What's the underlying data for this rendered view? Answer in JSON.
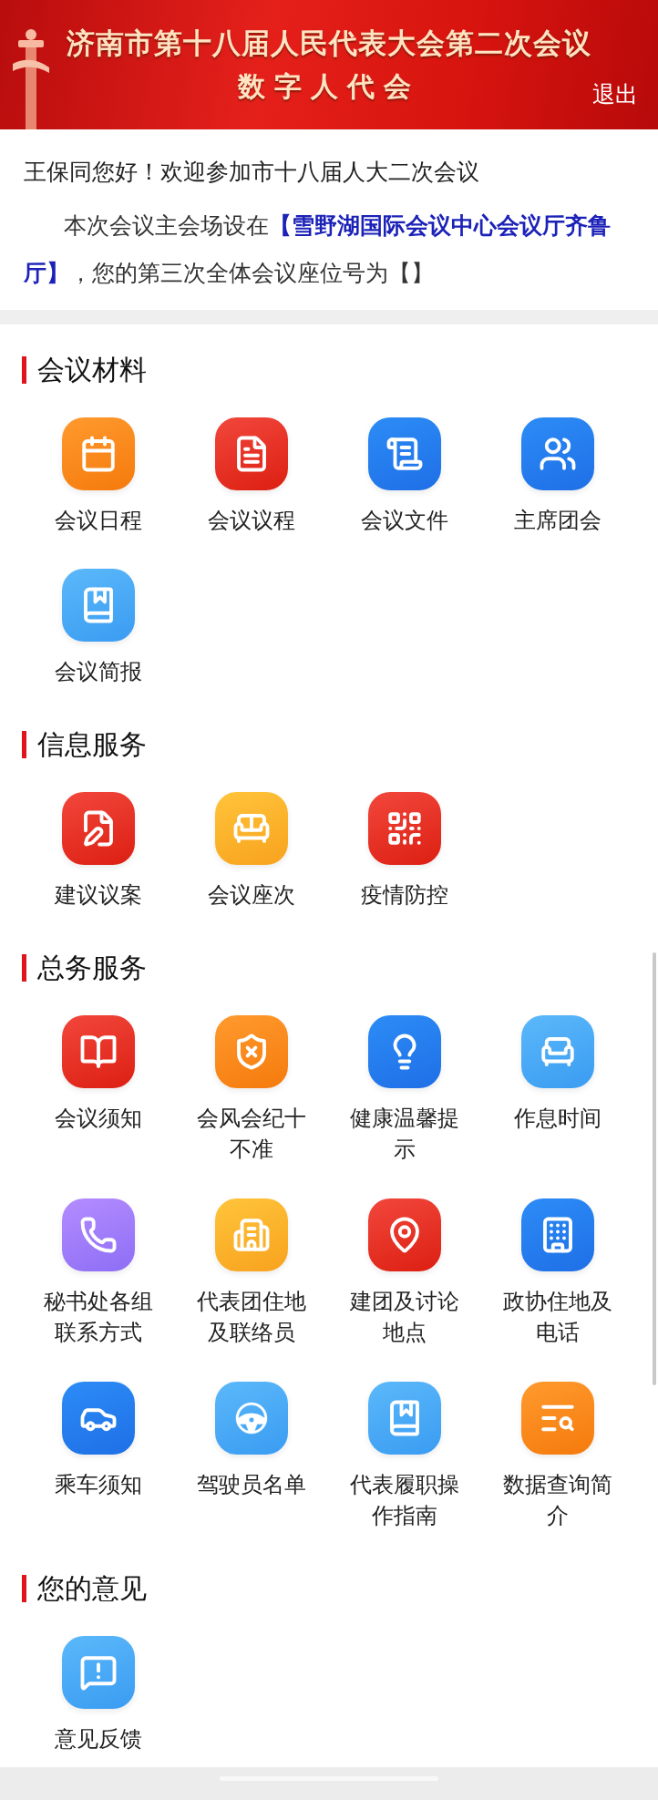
{
  "header": {
    "title": "济南市第十八届人民代表大会第二次会议",
    "subtitle": "数字人代会",
    "logout": "退出"
  },
  "welcome": {
    "greeting": "王保同您好！欢迎参加市十八届人大二次会议",
    "notice": "本次会议主会场设在**【雪野湖国际会议中心会议厅齐鲁厅】**，您的第三次全体会议座位号为【】"
  },
  "sections": [
    {
      "title": "会议材料",
      "items": [
        {
          "label": "会议日程",
          "kind": "calendar"
        },
        {
          "label": "会议议程",
          "kind": "document"
        },
        {
          "label": "会议文件",
          "kind": "scroll"
        },
        {
          "label": "主席团会",
          "kind": "group"
        },
        {
          "label": "会议简报",
          "kind": "book"
        }
      ]
    },
    {
      "title": "信息服务",
      "items": [
        {
          "label": "建议议案",
          "kind": "edit"
        },
        {
          "label": "会议座次",
          "kind": "sofa"
        },
        {
          "label": "疫情防控",
          "kind": "qr"
        }
      ]
    },
    {
      "title": "总务服务",
      "items": [
        {
          "label": "会议须知",
          "kind": "handbook"
        },
        {
          "label": "会风会纪十不准",
          "kind": "shield"
        },
        {
          "label": "健康温馨提示",
          "kind": "bulb"
        },
        {
          "label": "作息时间",
          "kind": "seat"
        },
        {
          "label": "秘书处各组联系方式",
          "kind": "contact"
        },
        {
          "label": "代表团住地及联络员",
          "kind": "building"
        },
        {
          "label": "建团及讨论地点",
          "kind": "location"
        },
        {
          "label": "政协住地及电话",
          "kind": "office"
        },
        {
          "label": "乘车须知",
          "kind": "car"
        },
        {
          "label": "驾驶员名单",
          "kind": "wheel"
        },
        {
          "label": "代表履职操作指南",
          "kind": "guide"
        },
        {
          "label": "数据查询简介",
          "kind": "search"
        }
      ]
    },
    {
      "title": "您的意见",
      "items": [
        {
          "label": "意见反馈",
          "kind": "feedback"
        }
      ]
    }
  ]
}
